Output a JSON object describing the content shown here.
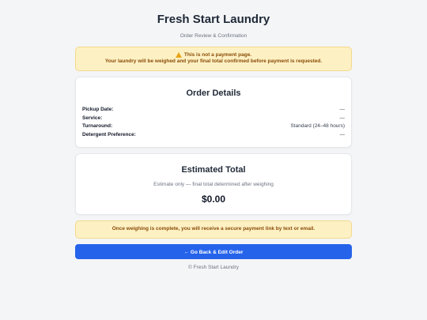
{
  "header": {
    "brand": "Fresh Start Laundry",
    "subtitle": "Order Review & Confirmation"
  },
  "warning": {
    "icon": "warning-icon",
    "title": "This is not a payment page.",
    "message": "Your laundry will be weighed and your final total confirmed before payment is requested."
  },
  "details": {
    "heading": "Order Details",
    "rows": [
      {
        "label": "Pickup Date:",
        "value": "—"
      },
      {
        "label": "Service:",
        "value": "—"
      },
      {
        "label": "Turnaround:",
        "value": "Standard (24–48 hours)"
      },
      {
        "label": "Detergent Preference:",
        "value": "—"
      }
    ]
  },
  "total": {
    "heading": "Estimated Total",
    "note": "Estimate only — final total determined after weighing",
    "amount": "$0.00"
  },
  "notice": {
    "text": "Once weighing is complete, you will receive a secure payment link by text or email."
  },
  "actions": {
    "back_label": "← Go Back & Edit Order"
  },
  "footer": {
    "text": "© Fresh Start Laundry"
  },
  "colors": {
    "accent": "#2563eb",
    "warning_bg": "#fdf1c4",
    "warning_text": "#8a4b06"
  }
}
